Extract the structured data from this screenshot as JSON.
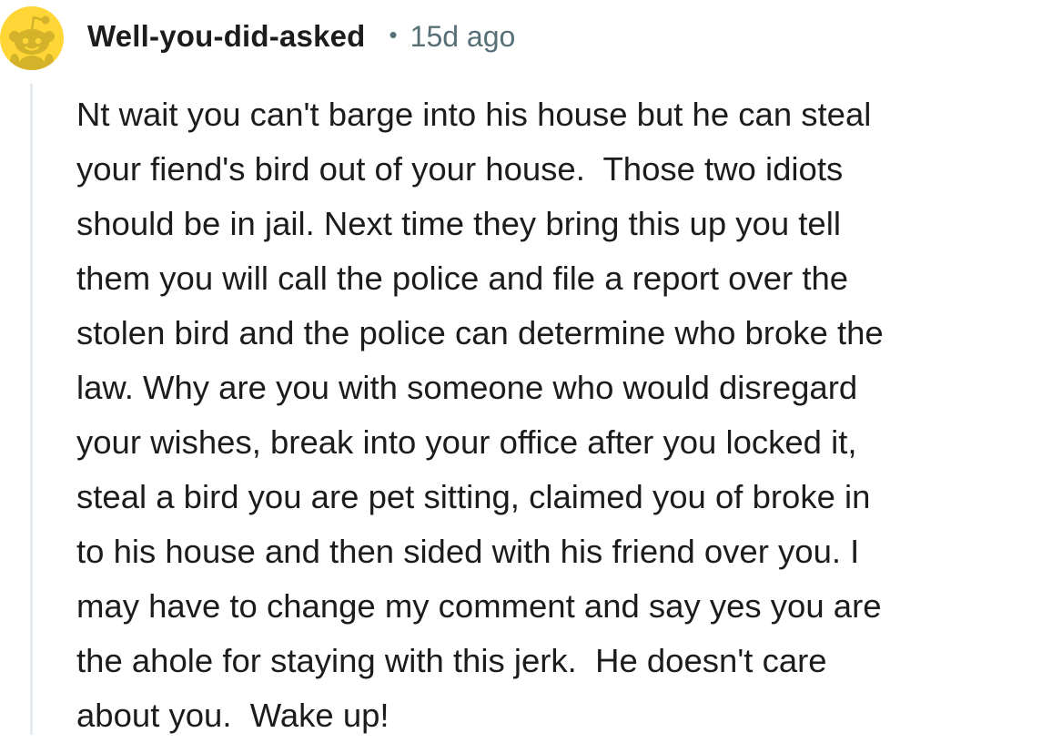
{
  "comment": {
    "author": "Well-you-did-asked",
    "separator": "•",
    "time_ago": "15d ago",
    "body": "Nt wait you can't barge into his house but he can steal\nyour fiend's bird out of your house.  Those two idiots\nshould be in jail. Next time they bring this up you tell\nthem you will call the police and file a report over the\nstolen bird and the police can determine who broke the\nlaw. Why are you with someone who would disregard\nyour wishes, break into your office after you locked it,\nsteal a bird you are pet sitting, claimed you of broke in\nto his house and then sided with his friend over you. I\nmay have to change my comment and say yes you are\nthe ahole for staying with this jerk.  He doesn't care\nabout you.  Wake up!"
  },
  "avatar": {
    "icon": "reddit-snoo-avatar-icon",
    "background_color": "#ffd635",
    "figure_color": "#d4b32a"
  },
  "colors": {
    "text": "#1c1c1c",
    "meta": "#576f76",
    "thread_line": "#e5ebee"
  }
}
